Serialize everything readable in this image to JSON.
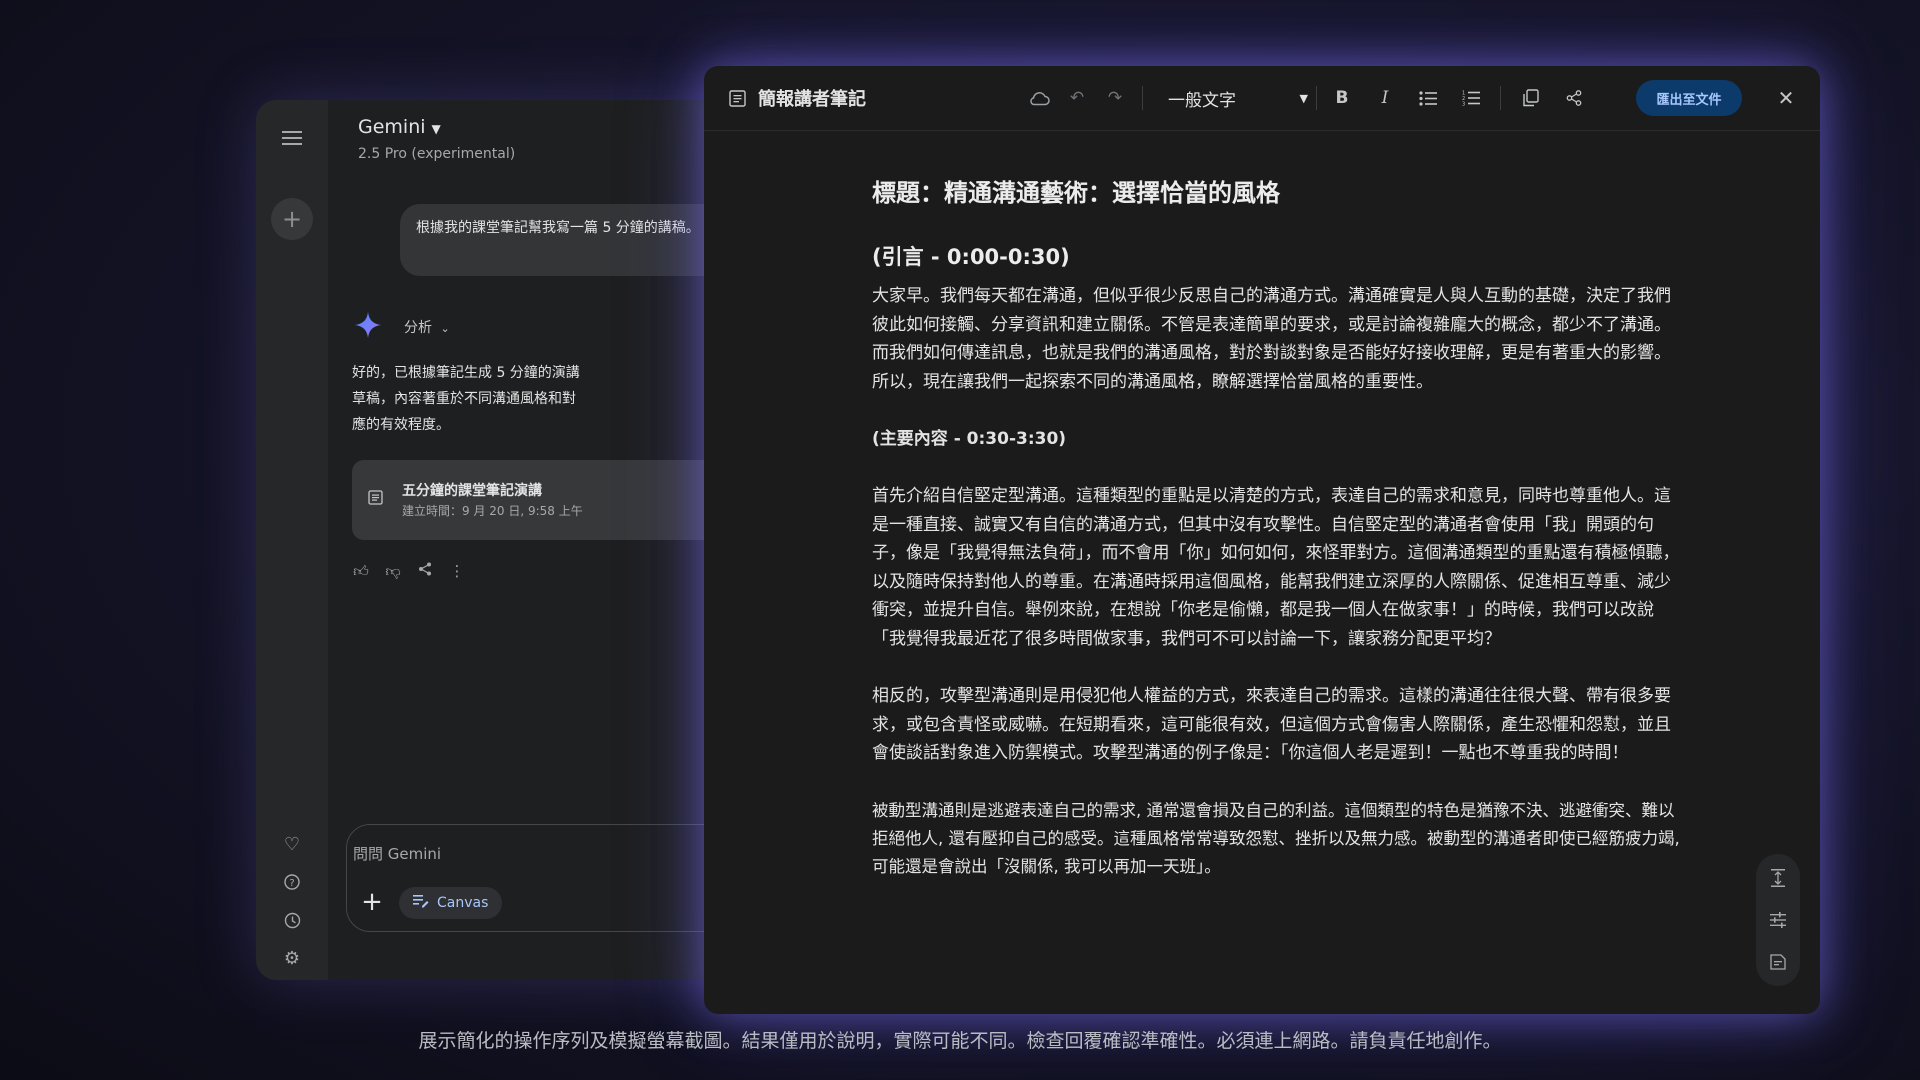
{
  "gemini": {
    "title": "Gemini",
    "model": "2.5 Pro (experimental)",
    "user_prompt": "根據我的課堂筆記幫我寫一篇 5 分鐘的講稿。",
    "analysis_label": "分析",
    "response": "好的，已根據筆記生成 5 分鐘的演講草稿，內容著重於不同溝通風格和對應的有效程度。",
    "doc_card": {
      "title": "五分鐘的課堂筆記演講",
      "meta": "建立時間：9 月 20 日, 9:58 上午"
    },
    "input_placeholder": "問問 Gemini",
    "canvas_label": "Canvas"
  },
  "editor": {
    "title": "簡報講者筆記",
    "style_select": "一般文字",
    "export_label": "匯出至文件",
    "heading": "標題：精通溝通藝術：選擇恰當的風格",
    "intro_heading": "(引言 - 0:00-0:30)",
    "intro_paragraph": "大家早。我們每天都在溝通，但似乎很少反思自己的溝通方式。溝通確實是人與人互動的基礎，決定了我們彼此如何接觸、分享資訊和建立關係。不管是表達簡單的要求，或是討論複雜龐大的概念，都少不了溝通。而我們如何傳達訊息，也就是我們的溝通風格，對於對談對象是否能好好接收理解，更是有著重大的影響。所以，現在讓我們一起探索不同的溝通風格，瞭解選擇恰當風格的重要性。",
    "main_heading": "(主要內容 - 0:30-3:30)",
    "paragraph_assertive": "首先介紹自信堅定型溝通。這種類型的重點是以清楚的方式，表達自己的需求和意見，同時也尊重他人。這是一種直接、誠實又有自信的溝通方式，但其中沒有攻擊性。自信堅定型的溝通者會使用「我」開頭的句子，像是「我覺得無法負荷」，而不會用「你」如何如何，來怪罪對方。這個溝通類型的重點還有積極傾聽，以及隨時保持對他人的尊重。在溝通時採用這個風格，能幫我們建立深厚的人際關係、促進相互尊重、減少衝突，並提升自信。舉例來說，在想說「你老是偷懶，都是我一個人在做家事！」的時候，我們可以改說「我覺得我最近花了很多時間做家事，我們可不可以討論一下，讓家務分配更平均？",
    "paragraph_aggressive": "相反的，攻擊型溝通則是用侵犯他人權益的方式，來表達自己的需求。這樣的溝通往往很大聲、帶有很多要求，或包含責怪或威嚇。在短期看來，這可能很有效，但這個方式會傷害人際關係，產生恐懼和怨懟，並且會使談話對象進入防禦模式。攻擊型溝通的例子像是：「你這個人老是遲到！一點也不尊重我的時間！",
    "paragraph_passive": "被動型溝通則是逃避表達自己的需求, 通常還會損及自己的利益。這個類型的特色是猶豫不決、逃避衝突、難以拒絕他人, 還有壓抑自己的感受。這種風格常常導致怨懟、挫折以及無力感。被動型的溝通者即使已經筋疲力竭, 可能還是會說出「沒關係, 我可以再加一天班」。"
  },
  "disclaimer": "展示簡化的操作序列及模擬螢幕截圖。結果僅用於說明，實際可能不同。檢查回覆確認準確性。必須連上網路。請負責任地創作。",
  "icons": {
    "menu": "menu-icon",
    "new_chat": "plus-icon",
    "gem": "heart-icon",
    "help": "help-icon",
    "activity": "history-icon",
    "settings": "gear-icon",
    "sparkle": "gemini-sparkle-icon",
    "document": "document-icon",
    "cloud": "cloud-icon",
    "undo": "undo-icon",
    "redo": "redo-icon",
    "bold": "bold-icon",
    "italic": "italic-icon",
    "bullets": "bullet-list-icon",
    "numbered": "numbered-list-icon",
    "copy": "copy-icon",
    "share": "share-icon",
    "close": "close-icon",
    "mic": "mic-icon"
  },
  "colors": {
    "accent": "#a8c7fa",
    "export_button_bg": "#0b3a6b",
    "sparkle": "#4285f4",
    "editor_glow": "#8278ff"
  }
}
